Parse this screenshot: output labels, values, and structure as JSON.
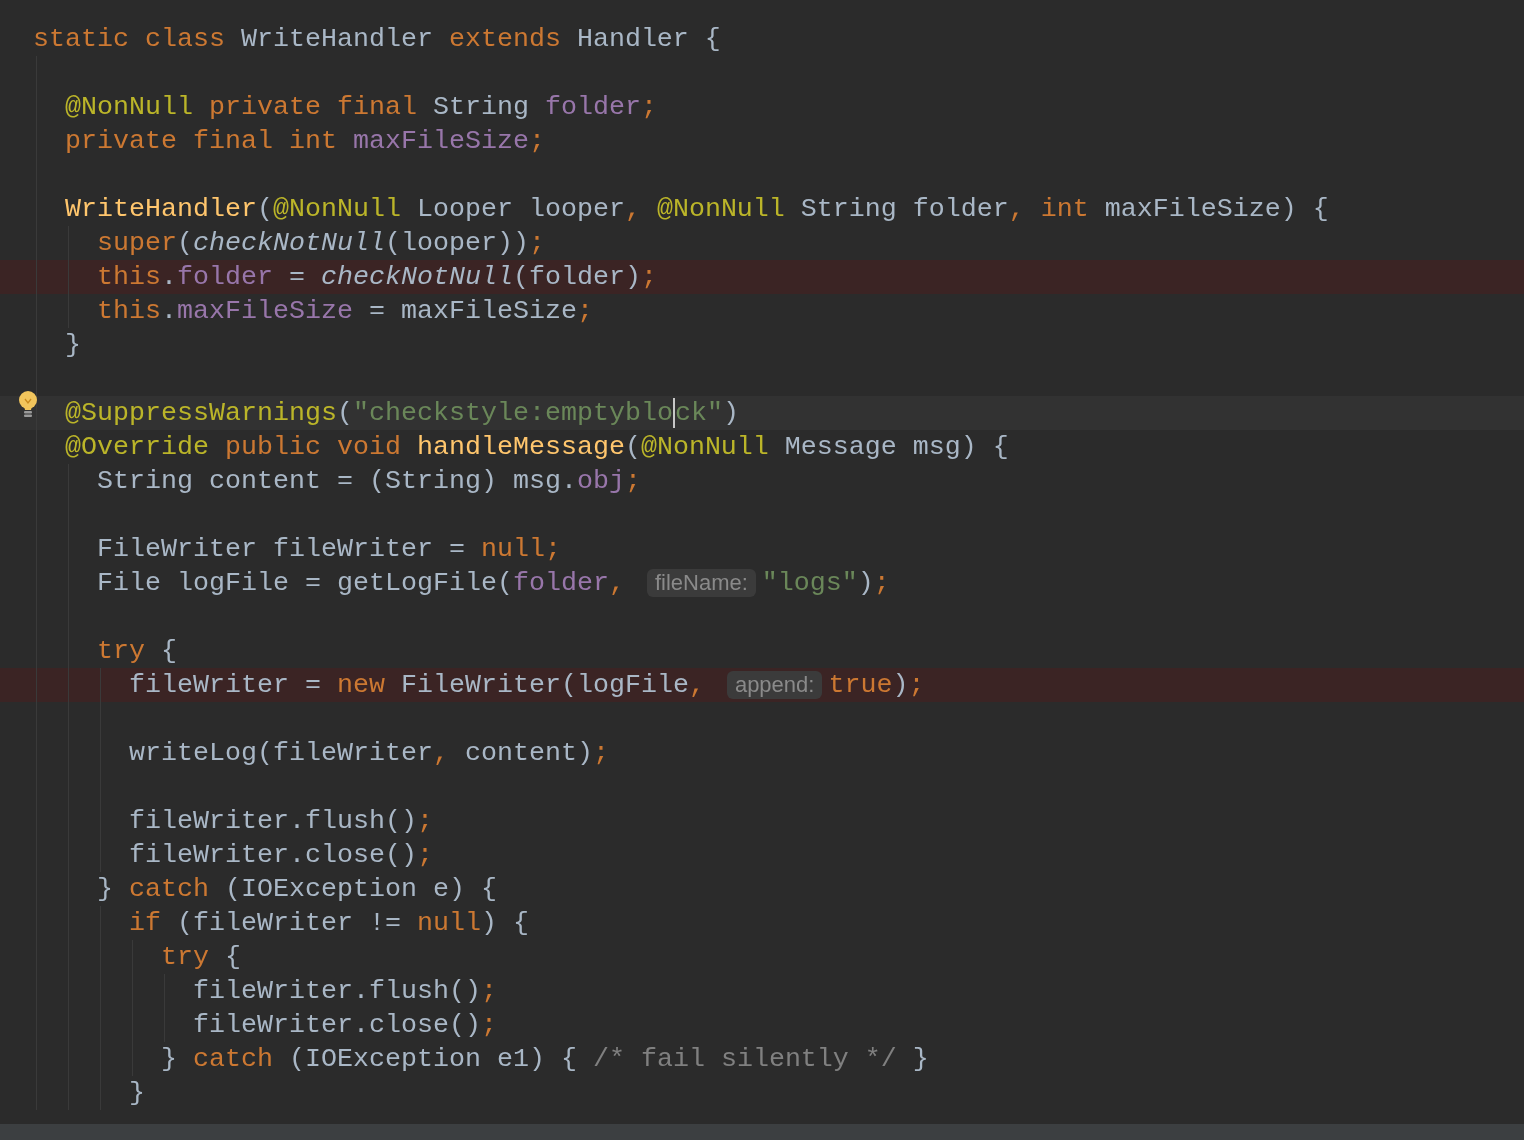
{
  "editor": {
    "lines": [
      {
        "kind": "code",
        "tokens": [
          {
            "kind": "kw",
            "t": "static class "
          },
          {
            "kind": "plain",
            "t": "WriteHandler "
          },
          {
            "kind": "kw",
            "t": "extends "
          },
          {
            "kind": "plain",
            "t": "Handler {"
          }
        ],
        "children": [
          {
            "kind": "blank"
          },
          {
            "kind": "code",
            "tokens": [
              {
                "kind": "ann",
                "t": "@NonNull "
              },
              {
                "kind": "kw",
                "t": "private final "
              },
              {
                "kind": "plain",
                "t": "String "
              },
              {
                "kind": "field",
                "t": "folder"
              },
              {
                "kind": "kw",
                "t": ";"
              }
            ]
          },
          {
            "kind": "code",
            "tokens": [
              {
                "kind": "kw",
                "t": "private final int "
              },
              {
                "kind": "field",
                "t": "maxFileSize"
              },
              {
                "kind": "kw",
                "t": ";"
              }
            ]
          },
          {
            "kind": "blank"
          },
          {
            "kind": "code",
            "tokens": [
              {
                "kind": "decl",
                "t": "WriteHandler"
              },
              {
                "kind": "plain",
                "t": "("
              },
              {
                "kind": "ann",
                "t": "@NonNull "
              },
              {
                "kind": "plain",
                "t": "Looper looper"
              },
              {
                "kind": "kw",
                "t": ", "
              },
              {
                "kind": "ann",
                "t": "@NonNull "
              },
              {
                "kind": "plain",
                "t": "String folder"
              },
              {
                "kind": "kw",
                "t": ", int "
              },
              {
                "kind": "plain",
                "t": "maxFileSize) {"
              }
            ],
            "children": [
              {
                "kind": "code",
                "tokens": [
                  {
                    "kind": "kw",
                    "t": "super"
                  },
                  {
                    "kind": "plain",
                    "t": "("
                  },
                  {
                    "kind": "ital",
                    "t": "checkNotNull"
                  },
                  {
                    "kind": "plain",
                    "t": "(looper))"
                  },
                  {
                    "kind": "kw",
                    "t": ";"
                  }
                ]
              },
              {
                "kind": "error",
                "tokens": [
                  {
                    "kind": "kw",
                    "t": "this"
                  },
                  {
                    "kind": "plain",
                    "t": "."
                  },
                  {
                    "kind": "field",
                    "t": "folder"
                  },
                  {
                    "kind": "plain",
                    "t": " = "
                  },
                  {
                    "kind": "ital",
                    "t": "checkNotNull"
                  },
                  {
                    "kind": "plain",
                    "t": "(folder)"
                  },
                  {
                    "kind": "kw",
                    "t": ";"
                  }
                ]
              },
              {
                "kind": "code",
                "tokens": [
                  {
                    "kind": "kw",
                    "t": "this"
                  },
                  {
                    "kind": "plain",
                    "t": "."
                  },
                  {
                    "kind": "field",
                    "t": "maxFileSize"
                  },
                  {
                    "kind": "plain",
                    "t": " = maxFileSize"
                  },
                  {
                    "kind": "kw",
                    "t": ";"
                  }
                ]
              }
            ]
          },
          {
            "kind": "code",
            "tokens": [
              {
                "kind": "plain",
                "t": "}"
              }
            ]
          },
          {
            "kind": "blank"
          },
          {
            "kind": "current",
            "bulb": true,
            "tokens": [
              {
                "kind": "ann",
                "t": "@SuppressWarnings"
              },
              {
                "kind": "plain",
                "t": "("
              },
              {
                "kind": "str",
                "t": "\"checkstyle:emptyblo"
              },
              {
                "kind": "caret"
              },
              {
                "kind": "str",
                "t": "ck\""
              },
              {
                "kind": "plain",
                "t": ")"
              }
            ]
          },
          {
            "kind": "code",
            "tokens": [
              {
                "kind": "ann",
                "t": "@Override "
              },
              {
                "kind": "kw",
                "t": "public void "
              },
              {
                "kind": "decl",
                "t": "handleMessage"
              },
              {
                "kind": "plain",
                "t": "("
              },
              {
                "kind": "ann",
                "t": "@NonNull "
              },
              {
                "kind": "plain",
                "t": "Message msg) {"
              }
            ],
            "children": [
              {
                "kind": "code",
                "tokens": [
                  {
                    "kind": "plain",
                    "t": "String content = (String) msg."
                  },
                  {
                    "kind": "field",
                    "t": "obj"
                  },
                  {
                    "kind": "kw",
                    "t": ";"
                  }
                ]
              },
              {
                "kind": "blank"
              },
              {
                "kind": "code",
                "tokens": [
                  {
                    "kind": "plain",
                    "t": "FileWriter fileWriter = "
                  },
                  {
                    "kind": "kw",
                    "t": "null;"
                  }
                ]
              },
              {
                "kind": "code",
                "tokens": [
                  {
                    "kind": "plain",
                    "t": "File logFile = getLogFile("
                  },
                  {
                    "kind": "field",
                    "t": "folder"
                  },
                  {
                    "kind": "kw",
                    "t": ", "
                  },
                  {
                    "kind": "hint",
                    "t": "fileName:"
                  },
                  {
                    "kind": "str",
                    "t": "\"logs\""
                  },
                  {
                    "kind": "plain",
                    "t": ")"
                  },
                  {
                    "kind": "kw",
                    "t": ";"
                  }
                ]
              },
              {
                "kind": "blank"
              },
              {
                "kind": "code",
                "tokens": [
                  {
                    "kind": "kw",
                    "t": "try "
                  },
                  {
                    "kind": "plain",
                    "t": "{"
                  }
                ],
                "children": [
                  {
                    "kind": "error",
                    "tokens": [
                      {
                        "kind": "plain",
                        "t": "fileWriter = "
                      },
                      {
                        "kind": "kw",
                        "t": "new "
                      },
                      {
                        "kind": "plain",
                        "t": "FileWriter(logFile"
                      },
                      {
                        "kind": "kw",
                        "t": ", "
                      },
                      {
                        "kind": "hint",
                        "t": "append:"
                      },
                      {
                        "kind": "kw",
                        "t": "true"
                      },
                      {
                        "kind": "plain",
                        "t": ")"
                      },
                      {
                        "kind": "kw",
                        "t": ";"
                      }
                    ]
                  },
                  {
                    "kind": "blank"
                  },
                  {
                    "kind": "code",
                    "tokens": [
                      {
                        "kind": "plain",
                        "t": "writeLog(fileWriter"
                      },
                      {
                        "kind": "kw",
                        "t": ", "
                      },
                      {
                        "kind": "plain",
                        "t": "content)"
                      },
                      {
                        "kind": "kw",
                        "t": ";"
                      }
                    ]
                  },
                  {
                    "kind": "blank"
                  },
                  {
                    "kind": "code",
                    "tokens": [
                      {
                        "kind": "plain",
                        "t": "fileWriter.flush()"
                      },
                      {
                        "kind": "kw",
                        "t": ";"
                      }
                    ]
                  },
                  {
                    "kind": "code",
                    "tokens": [
                      {
                        "kind": "plain",
                        "t": "fileWriter.close()"
                      },
                      {
                        "kind": "kw",
                        "t": ";"
                      }
                    ]
                  }
                ]
              },
              {
                "kind": "code",
                "tokens": [
                  {
                    "kind": "plain",
                    "t": "} "
                  },
                  {
                    "kind": "kw",
                    "t": "catch "
                  },
                  {
                    "kind": "plain",
                    "t": "(IOException e) {"
                  }
                ],
                "children": [
                  {
                    "kind": "code",
                    "tokens": [
                      {
                        "kind": "kw",
                        "t": "if "
                      },
                      {
                        "kind": "plain",
                        "t": "(fileWriter != "
                      },
                      {
                        "kind": "kw",
                        "t": "null"
                      },
                      {
                        "kind": "plain",
                        "t": ") {"
                      }
                    ],
                    "children": [
                      {
                        "kind": "code",
                        "tokens": [
                          {
                            "kind": "kw",
                            "t": "try "
                          },
                          {
                            "kind": "plain",
                            "t": "{"
                          }
                        ],
                        "children": [
                          {
                            "kind": "code",
                            "tokens": [
                              {
                                "kind": "plain",
                                "t": "fileWriter.flush()"
                              },
                              {
                                "kind": "kw",
                                "t": ";"
                              }
                            ]
                          },
                          {
                            "kind": "code",
                            "tokens": [
                              {
                                "kind": "plain",
                                "t": "fileWriter.close()"
                              },
                              {
                                "kind": "kw",
                                "t": ";"
                              }
                            ]
                          }
                        ]
                      },
                      {
                        "kind": "code",
                        "tokens": [
                          {
                            "kind": "plain",
                            "t": "} "
                          },
                          {
                            "kind": "kw",
                            "t": "catch "
                          },
                          {
                            "kind": "plain",
                            "t": "(IOException e1) { "
                          },
                          {
                            "kind": "cmt",
                            "t": "/* fail silently */"
                          },
                          {
                            "kind": "plain",
                            "t": " }"
                          }
                        ]
                      }
                    ]
                  },
                  {
                    "kind": "code",
                    "tokens": [
                      {
                        "kind": "plain",
                        "t": "}"
                      }
                    ]
                  }
                ]
              }
            ]
          }
        ]
      }
    ]
  }
}
